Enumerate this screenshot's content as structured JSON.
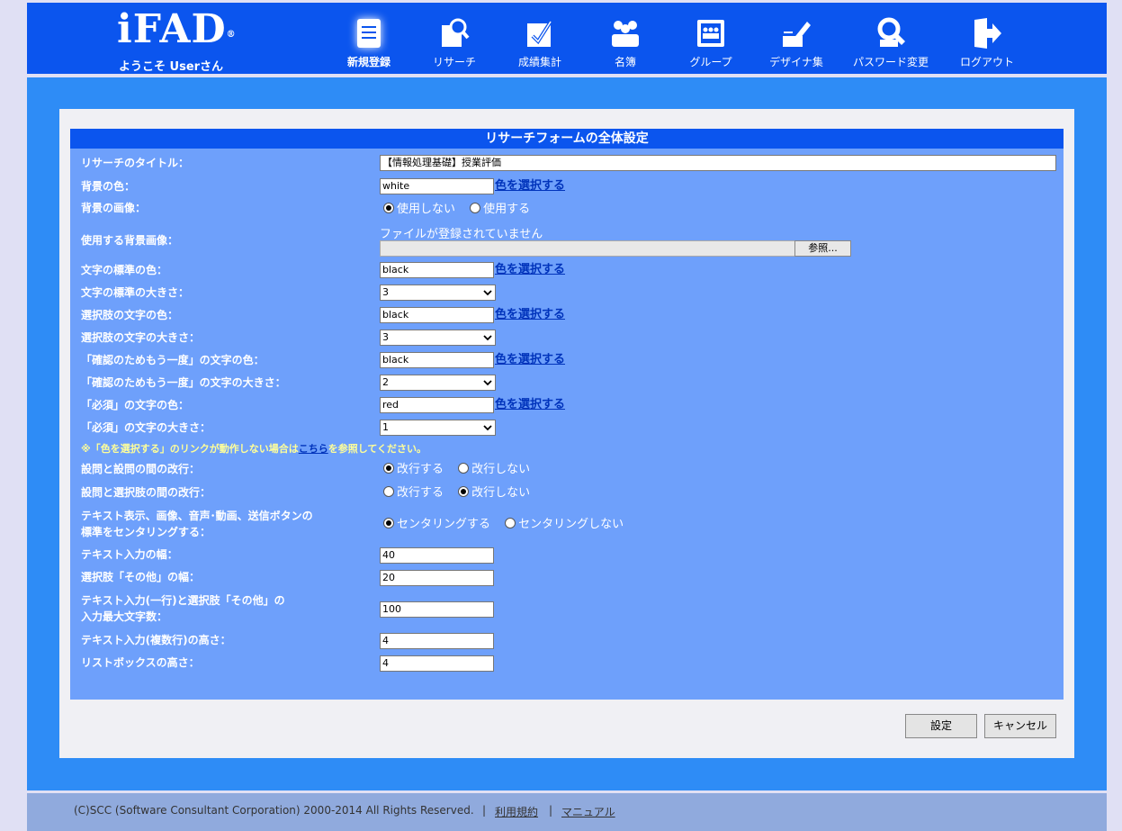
{
  "header": {
    "logo": "iFAD",
    "logo_mark": "®",
    "welcome": "ようこそ Userさん",
    "nav": [
      {
        "label": "新規登録",
        "icon": "new-registration-icon"
      },
      {
        "label": "リサーチ",
        "icon": "research-icon"
      },
      {
        "label": "成績集計",
        "icon": "grade-summary-icon"
      },
      {
        "label": "名簿",
        "icon": "roster-icon"
      },
      {
        "label": "グループ",
        "icon": "group-icon"
      },
      {
        "label": "デザイナ集",
        "icon": "designer-icon"
      },
      {
        "label": "パスワード変更",
        "icon": "password-change-icon"
      },
      {
        "label": "ログアウト",
        "icon": "logout-icon"
      }
    ],
    "active_nav": "新規登録"
  },
  "form": {
    "title": "リサーチフォームの全体設定",
    "color_link": "色を選択する",
    "research_title": {
      "label": "リサーチのタイトル：",
      "value": "【情報処理基礎】授業評価"
    },
    "bg_color": {
      "label": "背景の色：",
      "value": "white"
    },
    "bg_image": {
      "label": "背景の画像：",
      "options": [
        "使用しない",
        "使用する"
      ],
      "selected": "使用しない"
    },
    "bg_image_file": {
      "label": "使用する背景画像：",
      "status": "ファイルが登録されていません",
      "browse": "参照..."
    },
    "text_color": {
      "label": "文字の標準の色：",
      "value": "black"
    },
    "text_size": {
      "label": "文字の標準の大きさ：",
      "value": "3"
    },
    "choice_color": {
      "label": "選択肢の文字の色：",
      "value": "black"
    },
    "choice_size": {
      "label": "選択肢の文字の大きさ：",
      "value": "3"
    },
    "confirm_color": {
      "label": "「確認のためもう一度」の文字の色：",
      "value": "black"
    },
    "confirm_size": {
      "label": "「確認のためもう一度」の文字の大きさ：",
      "value": "2"
    },
    "required_color": {
      "label": "「必須」の文字の色：",
      "value": "red"
    },
    "required_size": {
      "label": "「必須」の文字の大きさ：",
      "value": "1"
    },
    "note": {
      "before": "※「色を選択する」のリンクが動作しない場合は",
      "link": "こちら",
      "after": "を参照してください。"
    },
    "q_break": {
      "label": "設問と設問の間の改行：",
      "options": [
        "改行する",
        "改行しない"
      ],
      "selected": "改行する"
    },
    "qc_break": {
      "label": "設問と選択肢の間の改行：",
      "options": [
        "改行する",
        "改行しない"
      ],
      "selected": "改行しない"
    },
    "centering": {
      "label_line1": "テキスト表示、画像、音声･動画、送信ボタンの",
      "label_line2": "標準をセンタリングする：",
      "options": [
        "センタリングする",
        "センタリングしない"
      ],
      "selected": "センタリングする"
    },
    "text_width": {
      "label": "テキスト入力の幅：",
      "value": "40"
    },
    "other_width": {
      "label": "選択肢「その他」の幅：",
      "value": "20"
    },
    "max_chars": {
      "label_line1": "テキスト入力(一行)と選択肢「その他」の",
      "label_line2": "入力最大文字数：",
      "value": "100"
    },
    "textarea_height": {
      "label": "テキスト入力(複数行)の高さ：",
      "value": "4"
    },
    "listbox_height": {
      "label": "リストボックスの高さ：",
      "value": "4"
    }
  },
  "buttons": {
    "submit": "設定",
    "cancel": "キャンセル"
  },
  "footer": {
    "copyright": "(C)SCC (Software Consultant Corporation) 2000-2014 All Rights Reserved.",
    "separator": "|",
    "terms": "利用規約",
    "manual": "マニュアル"
  },
  "colors": {
    "header": "#0b55ee",
    "band": "#2e8cf6",
    "form_bg": "#6ea0fb",
    "link": "#0033bb"
  }
}
